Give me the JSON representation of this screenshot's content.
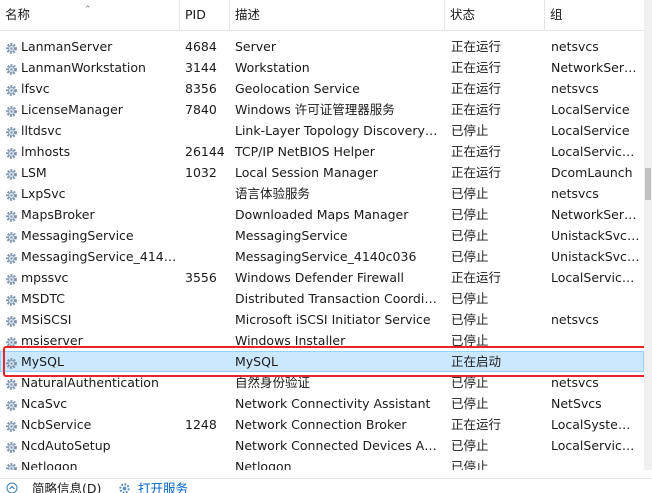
{
  "columns": {
    "name": "名称",
    "pid": "PID",
    "description": "描述",
    "status": "状态",
    "group": "组"
  },
  "rows": [
    {
      "name": "LanmanServer",
      "pid": "4684",
      "description": "Server",
      "status": "正在运行",
      "group": "netsvcs"
    },
    {
      "name": "LanmanWorkstation",
      "pid": "3144",
      "description": "Workstation",
      "status": "正在运行",
      "group": "NetworkServ..."
    },
    {
      "name": "lfsvc",
      "pid": "8356",
      "description": "Geolocation Service",
      "status": "正在运行",
      "group": "netsvcs"
    },
    {
      "name": "LicenseManager",
      "pid": "7840",
      "description": "Windows 许可证管理器服务",
      "status": "正在运行",
      "group": "LocalService"
    },
    {
      "name": "lltdsvc",
      "pid": "",
      "description": "Link-Layer Topology Discovery ...",
      "status": "已停止",
      "group": "LocalService"
    },
    {
      "name": "lmhosts",
      "pid": "26144",
      "description": "TCP/IP NetBIOS Helper",
      "status": "正在运行",
      "group": "LocalService..."
    },
    {
      "name": "LSM",
      "pid": "1032",
      "description": "Local Session Manager",
      "status": "正在运行",
      "group": "DcomLaunch"
    },
    {
      "name": "LxpSvc",
      "pid": "",
      "description": "语言体验服务",
      "status": "已停止",
      "group": "netsvcs"
    },
    {
      "name": "MapsBroker",
      "pid": "",
      "description": "Downloaded Maps Manager",
      "status": "已停止",
      "group": "NetworkServ..."
    },
    {
      "name": "MessagingService",
      "pid": "",
      "description": "MessagingService",
      "status": "已停止",
      "group": "UnistackSvcG..."
    },
    {
      "name": "MessagingService_4140c...",
      "pid": "",
      "description": "MessagingService_4140c036",
      "status": "已停止",
      "group": "UnistackSvcG..."
    },
    {
      "name": "mpssvc",
      "pid": "3556",
      "description": "Windows Defender Firewall",
      "status": "正在运行",
      "group": "LocalService..."
    },
    {
      "name": "MSDTC",
      "pid": "",
      "description": "Distributed Transaction Coordina...",
      "status": "已停止",
      "group": ""
    },
    {
      "name": "MSiSCSI",
      "pid": "",
      "description": "Microsoft iSCSI Initiator Service",
      "status": "已停止",
      "group": "netsvcs"
    },
    {
      "name": "msiserver",
      "pid": "",
      "description": "Windows Installer",
      "status": "已停止",
      "group": ""
    },
    {
      "name": "MySQL",
      "pid": "",
      "description": "MySQL",
      "status": "正在启动",
      "group": ""
    },
    {
      "name": "NaturalAuthentication",
      "pid": "",
      "description": "自然身份验证",
      "status": "已停止",
      "group": "netsvcs"
    },
    {
      "name": "NcaSvc",
      "pid": "",
      "description": "Network Connectivity Assistant",
      "status": "已停止",
      "group": "NetSvcs"
    },
    {
      "name": "NcbService",
      "pid": "1248",
      "description": "Network Connection Broker",
      "status": "正在运行",
      "group": "LocalSystem..."
    },
    {
      "name": "NcdAutoSetup",
      "pid": "",
      "description": "Network Connected Devices Aut...",
      "status": "已停止",
      "group": "LocalService..."
    },
    {
      "name": "Netlogon",
      "pid": "",
      "description": "Netlogon",
      "status": "已停止",
      "group": ""
    }
  ],
  "selected_row": "MySQL",
  "footer": {
    "fewer_details": "简略信息(D)",
    "open_services": "打开服务"
  },
  "colors": {
    "selection": "#cce8ff",
    "highlight_border": "#e8252a",
    "link": "#0066cc"
  }
}
